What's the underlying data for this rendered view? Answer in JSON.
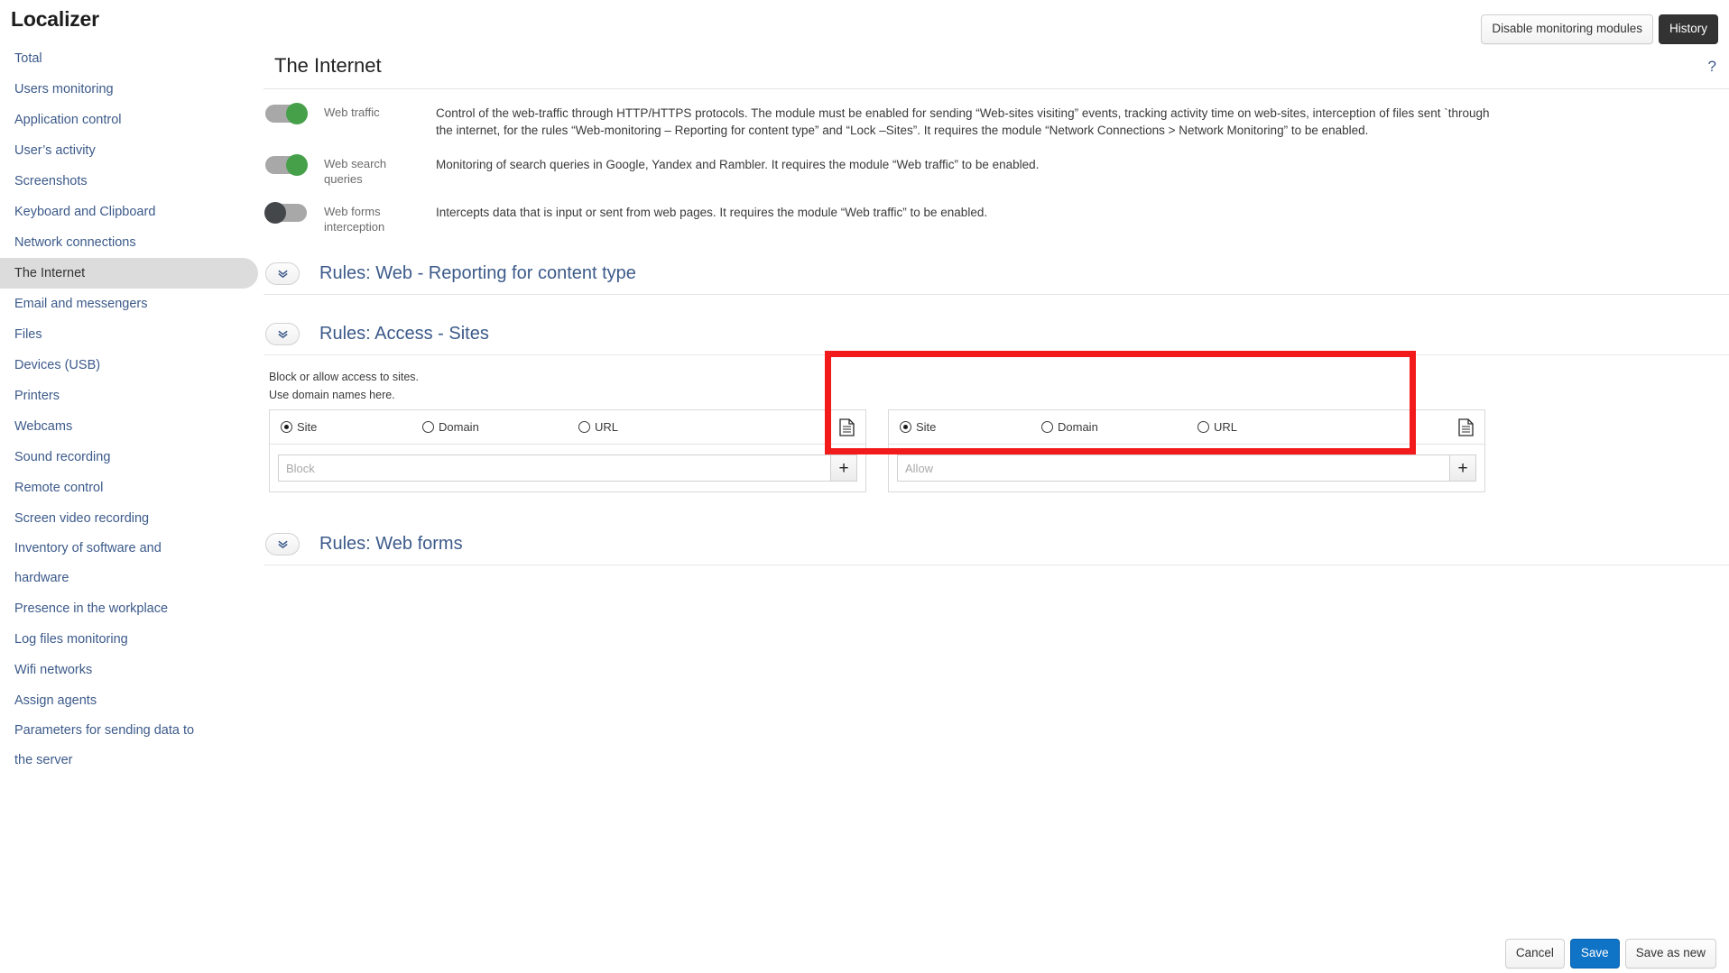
{
  "app": {
    "title": "Localizer"
  },
  "topbar": {
    "disable_modules_label": "Disable monitoring modules",
    "history_label": "History"
  },
  "sidebar": {
    "items": [
      {
        "label": "Total",
        "active": false
      },
      {
        "label": "Users monitoring",
        "active": false
      },
      {
        "label": "Application control",
        "active": false
      },
      {
        "label": "User’s activity",
        "active": false
      },
      {
        "label": "Screenshots",
        "active": false
      },
      {
        "label": "Keyboard and Clipboard",
        "active": false
      },
      {
        "label": "Network connections",
        "active": false
      },
      {
        "label": "The Internet",
        "active": true
      },
      {
        "label": "Email and messengers",
        "active": false
      },
      {
        "label": "Files",
        "active": false
      },
      {
        "label": "Devices (USB)",
        "active": false
      },
      {
        "label": "Printers",
        "active": false
      },
      {
        "label": "Webcams",
        "active": false
      },
      {
        "label": "Sound recording",
        "active": false
      },
      {
        "label": "Remote control",
        "active": false
      },
      {
        "label": "Screen video recording",
        "active": false
      },
      {
        "label": "Inventory of software and hardware",
        "active": false
      },
      {
        "label": "Presence in the workplace",
        "active": false
      },
      {
        "label": "Log files monitoring",
        "active": false
      },
      {
        "label": "Wifi networks",
        "active": false
      },
      {
        "label": "Assign agents",
        "active": false
      },
      {
        "label": "Parameters for sending data to the server",
        "active": false
      }
    ]
  },
  "page": {
    "title": "The Internet",
    "help_glyph": "?"
  },
  "modules": [
    {
      "label": "Web traffic",
      "state": "on",
      "description": "Control of the web-traffic through HTTP/HTTPS protocols. The module must be enabled for sending “Web-sites visiting” events, tracking activity time on web-sites, interception of files sent `through the internet, for the rules “Web-monitoring – Reporting for content type” and “Lock –Sites”. It requires the module “Network Connections > Network Monitoring” to be enabled."
    },
    {
      "label": "Web search queries",
      "state": "on",
      "description": "Monitoring of search queries in Google, Yandex and Rambler. It requires the module “Web traffic” to be enabled."
    },
    {
      "label": "Web forms interception",
      "state": "off",
      "description": "Intercepts data that is input or sent from web pages. It requires the module “Web traffic” to be enabled."
    }
  ],
  "rules_sections": [
    {
      "title": "Rules: Web - Reporting for content type",
      "expanded": false
    },
    {
      "title": "Rules: Access - Sites",
      "expanded": true
    },
    {
      "title": "Rules: Web forms",
      "expanded": false
    }
  ],
  "sites": {
    "hint_line1": "Block or allow access to sites.",
    "hint_line2": "Use domain names here.",
    "radio_options": [
      "Site",
      "Domain",
      "URL"
    ],
    "block_panel": {
      "selected_option": "Site",
      "input_value": "",
      "input_placeholder": "Block",
      "add_label": "+",
      "doc_icon": "document-icon"
    },
    "allow_panel": {
      "selected_option": "Site",
      "input_value": "",
      "input_placeholder": "Allow",
      "add_label": "+",
      "doc_icon": "document-icon",
      "highlighted": true,
      "highlight_color": "#f21a1a"
    }
  },
  "footer": {
    "cancel_label": "Cancel",
    "save_label": "Save",
    "save_as_new_label": "Save as new"
  }
}
